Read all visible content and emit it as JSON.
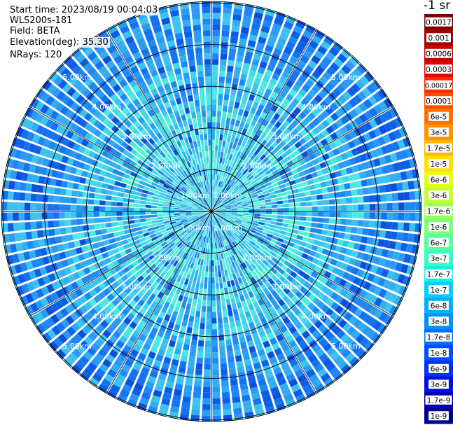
{
  "header": {
    "start_time": "Start time: 2023/08/19 00:04:03",
    "device": "WLS200s-181",
    "field": "Field: BETA",
    "elevation": "Elevation(deg): 35.30",
    "nrays": "NRays: 120"
  },
  "ppi": {
    "ring_labels": [
      "1.00km",
      "2.00km",
      "3.00km",
      "4.00km",
      "5.00km"
    ],
    "ray_count": 120
  },
  "colorbar": {
    "unit": "-1 sr",
    "ticks": [
      {
        "label": "0.0017",
        "color": "#7f0000"
      },
      {
        "label": "0.001",
        "color": "#a30000"
      },
      {
        "label": "0.0006",
        "color": "#c80000"
      },
      {
        "label": "0.0003",
        "color": "#ea0000"
      },
      {
        "label": "0.00017",
        "color": "#ff2a00"
      },
      {
        "label": "0.0001",
        "color": "#ff4d00"
      },
      {
        "label": "6e-5",
        "color": "#ff7100"
      },
      {
        "label": "3e-5",
        "color": "#ff9400"
      },
      {
        "label": "1.7e-5",
        "color": "#ffb800"
      },
      {
        "label": "1e-5",
        "color": "#ffe000"
      },
      {
        "label": "6e-6",
        "color": "#e6ff10"
      },
      {
        "label": "3e-6",
        "color": "#c3ff33"
      },
      {
        "label": "1.7e-6",
        "color": "#9fff57"
      },
      {
        "label": "1e-6",
        "color": "#7cff7a"
      },
      {
        "label": "6e-7",
        "color": "#57ff9f"
      },
      {
        "label": "3e-7",
        "color": "#33ffc3"
      },
      {
        "label": "1.7e-7",
        "color": "#10f0e6"
      },
      {
        "label": "1e-7",
        "color": "#00d0ff"
      },
      {
        "label": "6e-8",
        "color": "#00b0ff"
      },
      {
        "label": "3e-8",
        "color": "#0090ff"
      },
      {
        "label": "1.7e-8",
        "color": "#0070ff"
      },
      {
        "label": "1e-8",
        "color": "#0050ff"
      },
      {
        "label": "6e-9",
        "color": "#0030ff"
      },
      {
        "label": "3e-9",
        "color": "#0010e0"
      },
      {
        "label": "1.7e-9",
        "color": "#0000b8"
      },
      {
        "label": "1e-9",
        "color": "#00008f"
      }
    ]
  }
}
